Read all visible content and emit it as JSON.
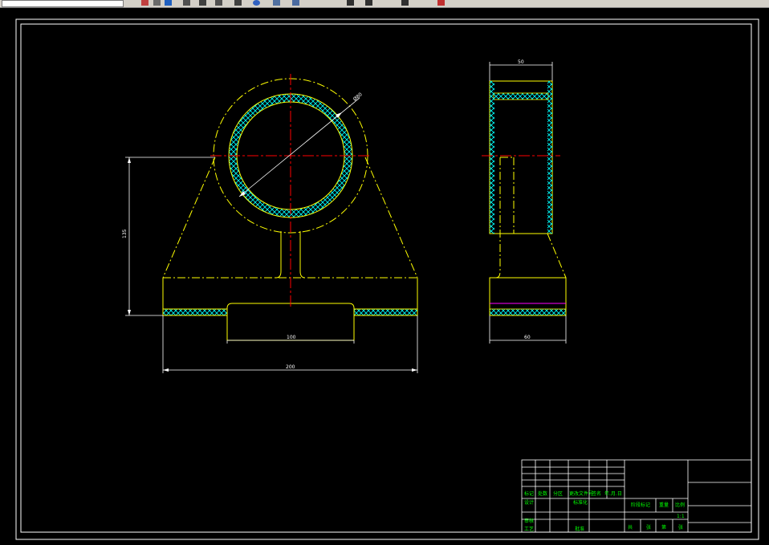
{
  "toolbar": {
    "icons": [
      "layer-icon",
      "properties-icon",
      "color-icon",
      "undo-icon",
      "print-icon",
      "copy-icon",
      "redo-icon",
      "zoom-icon",
      "grid-icon",
      "snap-icon",
      "ortho-icon",
      "draw-icon",
      "dimension-icon",
      "delete-icon"
    ]
  },
  "colors": {
    "background": "#000000",
    "frame": "#ffffff",
    "outline": "#ffff00",
    "centerline": "#ff0000",
    "hatch": "#00ffff",
    "dimension": "#ffffff",
    "title_text": "#00ff00"
  },
  "drawing": {
    "dimensions": {
      "front_height": "135",
      "front_slot_width": "100",
      "front_base_width": "200",
      "bore_diameter": "Ø80",
      "side_top_width": "50",
      "side_base_width": "60"
    },
    "title_block": {
      "header_row": [
        "标记",
        "处数",
        "分区",
        "更改文件号",
        "签名",
        "年.月.日"
      ],
      "designer": "设计",
      "standardize": "标准化",
      "stage_label": "阶段标记",
      "weight_label": "重量",
      "scale_label": "比例",
      "scale_value": "1:1",
      "checker": "审核",
      "process": "工艺",
      "approve": "批准",
      "sheet_row": [
        "共",
        "张",
        "第",
        "张"
      ]
    }
  }
}
